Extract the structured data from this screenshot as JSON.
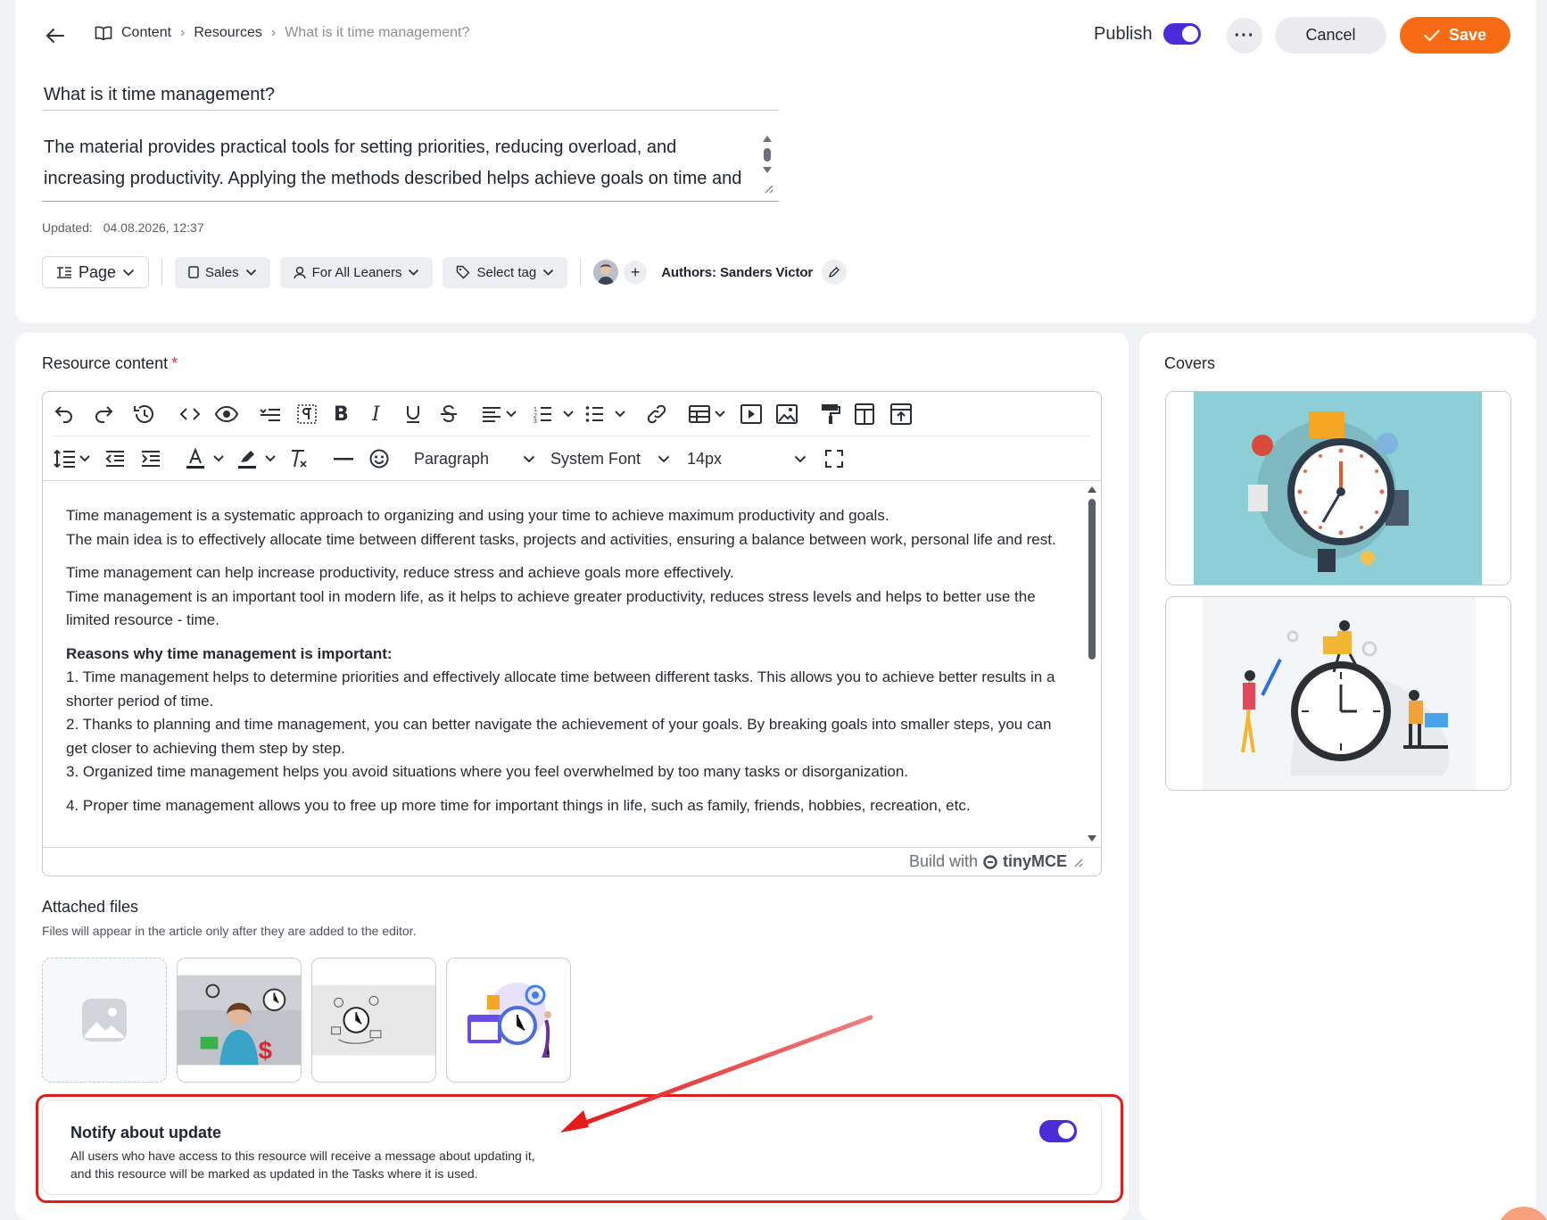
{
  "header": {
    "breadcrumb": [
      "Content",
      "Resources",
      "What is it time management?"
    ],
    "publish_label": "Publish",
    "publish_on": true,
    "more_label": "···",
    "cancel_label": "Cancel",
    "save_label": "Save",
    "title_value": "What is it time management?",
    "description": "The material provides practical tools for setting priorities, reducing overload, and increasing productivity. Applying the methods described helps achieve goals on time and",
    "updated_label": "Updated:",
    "updated_value": "04.08.2026, 12:37"
  },
  "chips": {
    "page": "Page",
    "category": "Sales",
    "audience": "For All Leaners",
    "tag": "Select tag",
    "plus": "+",
    "authors": "Authors: Sanders Victor"
  },
  "content": {
    "label": "Resource content",
    "required_mark": "*",
    "format_select": "Paragraph",
    "font_select": "System Font",
    "size_select": "14px",
    "paragraphs": [
      [
        "Time management is a systematic approach to organizing and using your time to achieve maximum productivity and goals.",
        "The main idea is to effectively allocate time between different tasks, projects and activities, ensuring a balance between work, personal life and rest."
      ],
      [
        "Time management can help increase productivity, reduce stress and achieve goals more effectively.",
        "Time management is an important tool in modern life, as it helps to achieve greater productivity, reduces stress levels and helps to better use the limited resource - time."
      ]
    ],
    "reasons_heading": "Reasons why time management is important:",
    "reasons": [
      "1. Time management helps to determine priorities and effectively allocate time between different tasks. This allows you to achieve better results in a shorter period of time.",
      "2. Thanks to planning and time management, you can better navigate the achievement of your goals. By breaking goals into smaller steps, you can get closer to achieving them step by step.",
      "3. Organized time management helps you avoid situations where you feel overwhelmed by too many tasks or disorganization."
    ],
    "reason_4": "4. Proper time management allows you to free up more time for important things in life, such as family, friends, hobbies, recreation, etc.",
    "footer_build": "Build with",
    "footer_brand": "tinyMCE"
  },
  "files": {
    "title": "Attached files",
    "subtitle": "Files will appear in the article only after they are added to the editor."
  },
  "notify": {
    "title": "Notify about update",
    "text_line1": "All users who have access to this resource will receive a message about updating it,",
    "text_line2": "and this resource will be marked as updated in the Tasks where it is used.",
    "enabled": true
  },
  "covers": {
    "title": "Covers"
  },
  "colors": {
    "accent": "#4b2bd8",
    "save": "#f76b15",
    "highlight": "#e21b1b",
    "cover_bg": "#8ccfd6"
  }
}
